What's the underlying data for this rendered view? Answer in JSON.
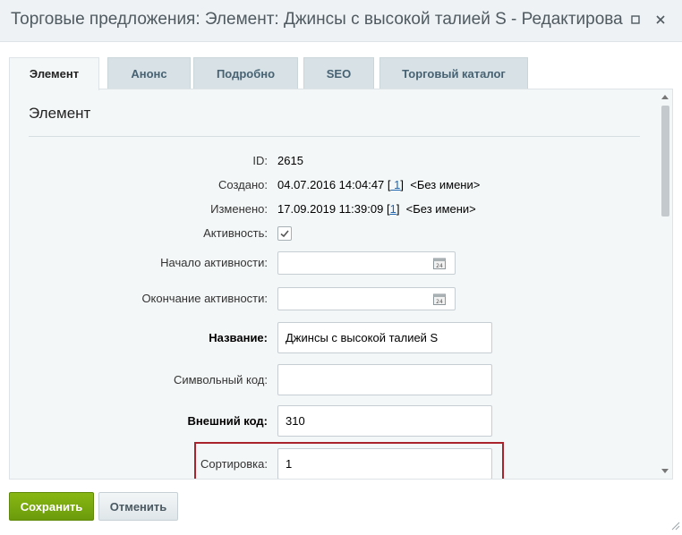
{
  "window": {
    "title": "Торговые предложения: Элемент: Джинсы с высокой талией S - Редактирование"
  },
  "tabs": [
    {
      "label": "Элемент",
      "active": true
    },
    {
      "label": "Анонс",
      "active": false
    },
    {
      "label": "Подробно",
      "active": false
    },
    {
      "label": "SEO",
      "active": false
    },
    {
      "label": "Торговый каталог",
      "active": false
    }
  ],
  "section": {
    "title": "Элемент"
  },
  "fields": {
    "id": {
      "label": "ID:",
      "value": "2615"
    },
    "created": {
      "label": "Создано:",
      "datetime": "04.07.2016 14:04:47",
      "bracket_open": "[",
      "user_id": " 1",
      "bracket_close": "]",
      "user_name": "<Без имени>"
    },
    "modified": {
      "label": "Изменено:",
      "datetime": "17.09.2019 11:39:09",
      "bracket_open": "[",
      "user_id": "1",
      "bracket_close": "]",
      "user_name": "<Без имени>"
    },
    "active": {
      "label": "Активность:",
      "checked": true
    },
    "active_from": {
      "label": "Начало активности:",
      "value": ""
    },
    "active_to": {
      "label": "Окончание активности:",
      "value": ""
    },
    "name": {
      "label": "Название:",
      "value": "Джинсы с высокой талией S"
    },
    "code": {
      "label": "Символьный код:",
      "value": ""
    },
    "external_code": {
      "label": "Внешний код:",
      "value": "310"
    },
    "sort": {
      "label": "Сортировка:",
      "value": "1"
    }
  },
  "buttons": {
    "save": "Сохранить",
    "cancel": "Отменить"
  },
  "colors": {
    "highlight": "#a8232c",
    "save_button": "#7aa90f",
    "link": "#2067b0"
  },
  "icons": {
    "maximize": "maximize-icon",
    "close": "close-icon",
    "calendar": "calendar-icon",
    "checkmark": "checkmark-icon",
    "resize": "resize-grip-icon"
  }
}
